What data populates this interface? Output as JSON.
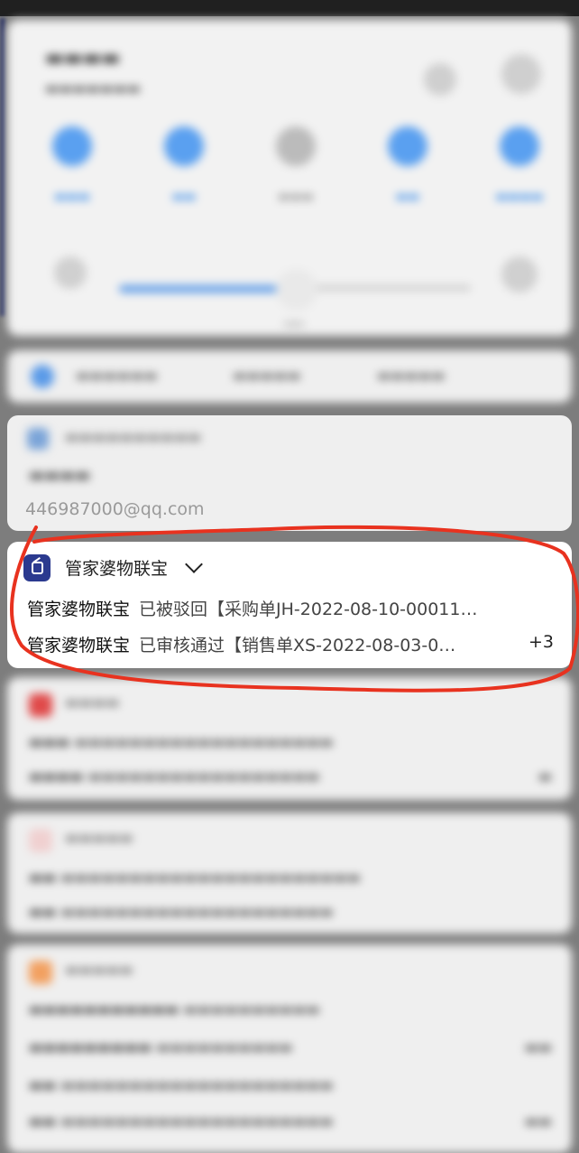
{
  "accent_color": "#5a9ae8",
  "annotation_color": "#e8321f",
  "quick_settings": {
    "tiles": [
      {
        "icon": "wifi-icon",
        "active": true
      },
      {
        "icon": "bluetooth-icon",
        "active": true
      },
      {
        "icon": "flashlight-icon",
        "active": false
      },
      {
        "icon": "eye-comfort-icon",
        "active": true
      },
      {
        "icon": "link-icon",
        "active": true
      }
    ],
    "brightness_level": 0.5
  },
  "mail_notification": {
    "email": "446987000@qq.com"
  },
  "focused_notification": {
    "app_name": "管家婆物联宝",
    "app_icon": "guanjiapo-app-icon",
    "messages": [
      {
        "sender": "管家婆物联宝",
        "text": "已被驳回【采购单JH-2022-08-10-00011…"
      },
      {
        "sender": "管家婆物联宝",
        "text": "已审核通过【销售单XS-2022-08-03-0…"
      }
    ],
    "more_count": "+3"
  }
}
